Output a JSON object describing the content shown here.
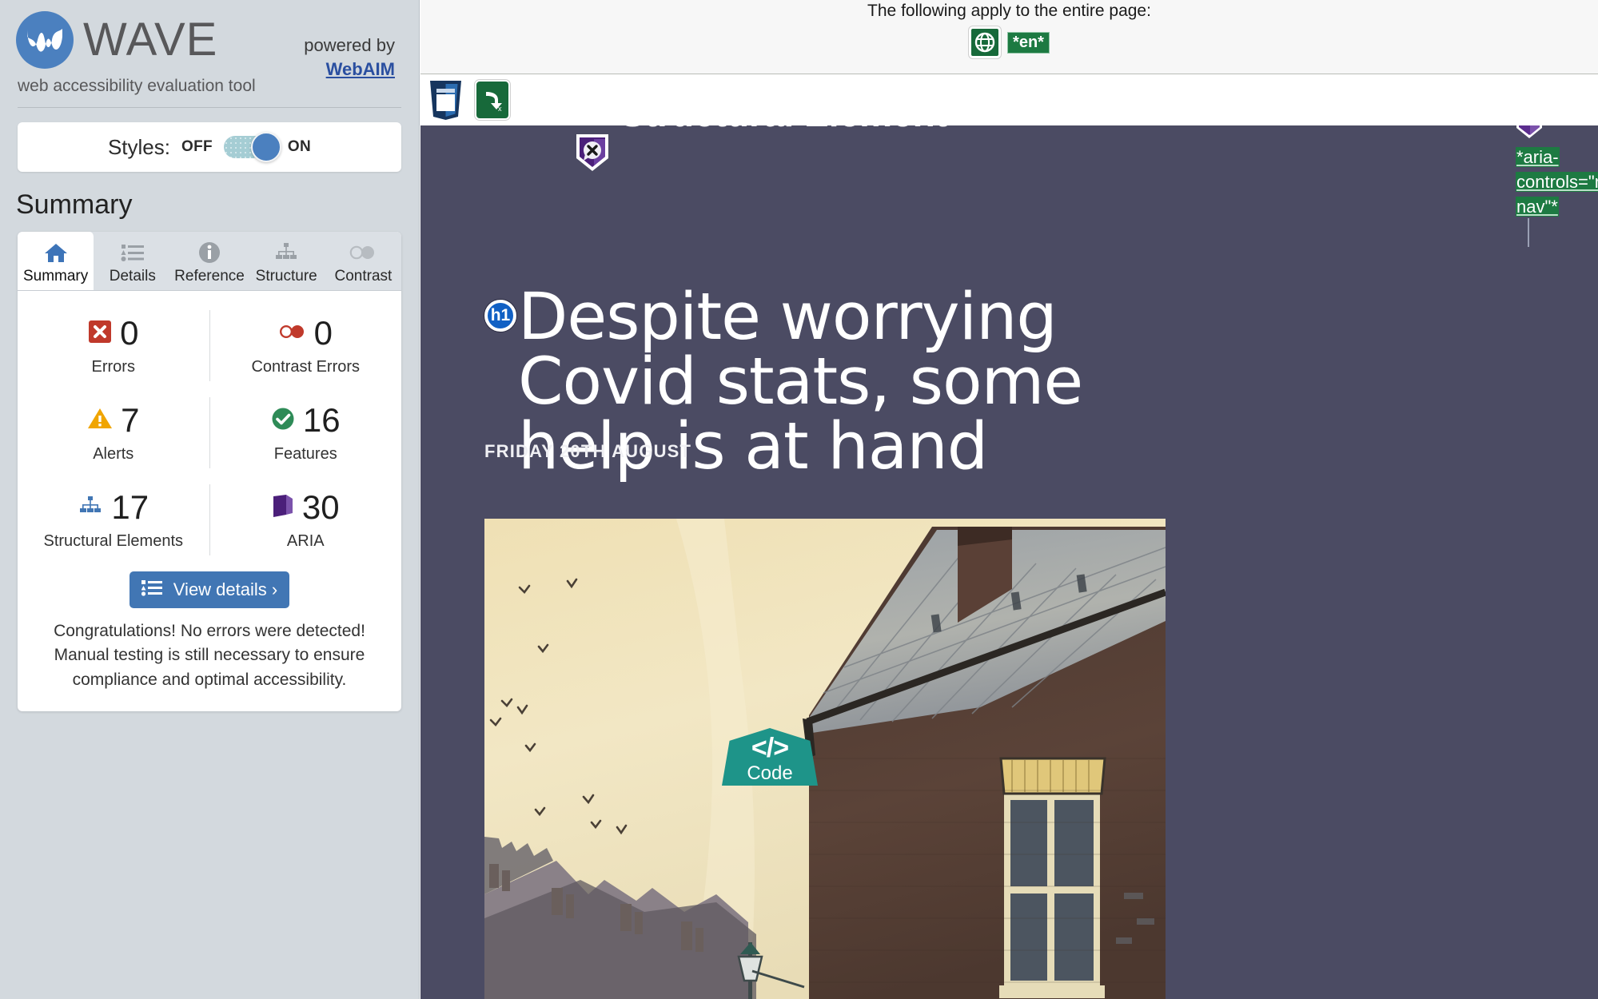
{
  "sidebar": {
    "brand": {
      "name": "WAVE",
      "tagline": "web accessibility evaluation tool",
      "logo_icon": "wave-logo-icon",
      "powered_by_label": "powered by",
      "powered_by_link": "WebAIM"
    },
    "styles": {
      "label": "Styles:",
      "off_label": "OFF",
      "on_label": "ON",
      "state": "ON"
    },
    "summary_heading": "Summary",
    "tabs": [
      {
        "label": "Summary",
        "icon": "home-icon",
        "active": true
      },
      {
        "label": "Details",
        "icon": "list-icon",
        "active": false
      },
      {
        "label": "Reference",
        "icon": "info-icon",
        "active": false
      },
      {
        "label": "Structure",
        "icon": "structure-icon",
        "active": false
      },
      {
        "label": "Contrast",
        "icon": "contrast-icon",
        "active": false
      }
    ],
    "stats": [
      {
        "value": "0",
        "label": "Errors",
        "icon": "error-icon",
        "color": "#c0392b"
      },
      {
        "value": "0",
        "label": "Contrast Errors",
        "icon": "contrast-icon",
        "color": "#c0392b"
      },
      {
        "value": "7",
        "label": "Alerts",
        "icon": "alert-icon",
        "color": "#f0a500"
      },
      {
        "value": "16",
        "label": "Features",
        "icon": "feature-icon",
        "color": "#2e8b57"
      },
      {
        "value": "17",
        "label": "Structural Elements",
        "icon": "structure-icon",
        "color": "#4176b4"
      },
      {
        "value": "30",
        "label": "ARIA",
        "icon": "aria-cube-icon",
        "color": "#5b2d8e"
      }
    ],
    "view_details_label": "View details ›",
    "view_details_icon": "list-icon",
    "congrats_text": "Congratulations! No errors were detected! Manual testing is still necessary to ensure compliance and optimal accessibility."
  },
  "main": {
    "page_banner": {
      "text": "The following apply to the entire page:",
      "globe_icon": "language-globe-icon",
      "lang_chip": "*en*"
    },
    "toolbar_icons": [
      {
        "name": "page-title-icon"
      },
      {
        "name": "skip-link-icon"
      }
    ],
    "article": {
      "cut_heading": "Structural Element",
      "shield_badge_icon": "aria-description-shield-icon",
      "aria_badge_icon": "aria-badge-icon",
      "aria_callout": "*aria-controls=\"menu-nav\"*",
      "h1_badge": "h1",
      "headline": "Despite worrying Covid stats, some help is at hand",
      "byline": "FRIDAY 20TH AUGUST",
      "illustration_alt": "watercolour-rooftops-illustration",
      "code_chip": {
        "glyph": "</>",
        "label": "Code"
      }
    }
  },
  "colors": {
    "sidebar_bg": "#d3d9de",
    "accent_blue": "#4176b4",
    "article_bg": "#4b4b63",
    "green": "#17693a",
    "teal": "#1e9489",
    "purple": "#5b2d8e"
  }
}
